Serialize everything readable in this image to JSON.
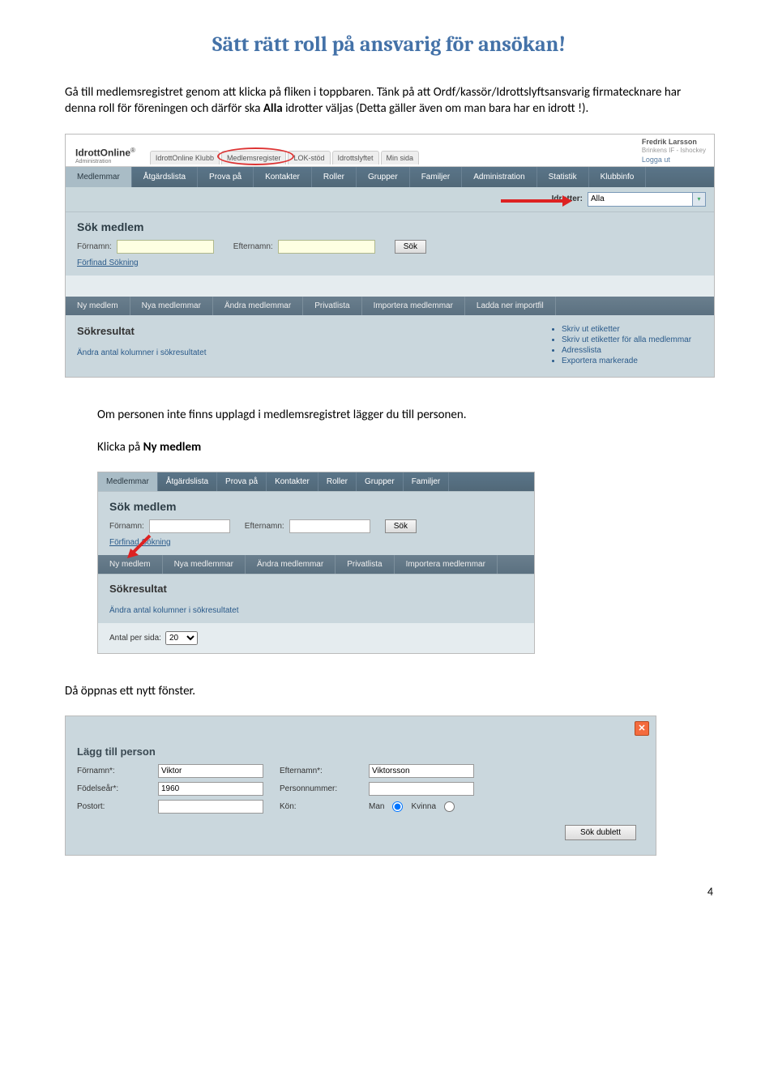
{
  "page_number": "4",
  "title": "Sätt rätt roll på ansvarig för ansökan!",
  "para1_a": "Gå till medlemsregistret genom att klicka på fliken i toppbaren. Tänk på att Ordf/kassör/Idrottslyftsansvarig firmatecknare har denna roll för föreningen och därför ska ",
  "para1_bold": "Alla",
  "para1_b": " idrotter väljas (Detta gäller även om man bara har en idrott !).",
  "para2": "Om personen inte finns upplagd i medlemsregistret lägger du till personen.",
  "para3_a": "Klicka på ",
  "para3_bold": "Ny medlem",
  "para4": "Då öppnas ett nytt fönster.",
  "shot1": {
    "logo": "IdrottOnline",
    "logoSub": "Administration",
    "topTabs": [
      "IdrottOnline Klubb",
      "Medlemsregister",
      "LOK-stöd",
      "Idrottslyftet",
      "Min sida"
    ],
    "user": {
      "name": "Fredrik Larsson",
      "org": "Brinkens IF - Ishockey",
      "logout": "Logga ut"
    },
    "nav": [
      "Medlemmar",
      "Åtgärdslista",
      "Prova på",
      "Kontakter",
      "Roller",
      "Grupper",
      "Familjer",
      "Administration",
      "Statistik",
      "Klubbinfo"
    ],
    "idrotter": {
      "label": "Idrotter:",
      "value": "Alla"
    },
    "sok": {
      "title": "Sök medlem",
      "fornamn": "Förnamn:",
      "efternamn": "Efternamn:",
      "btn": "Sök",
      "forfinad": "Förfinad Sökning"
    },
    "subnav": [
      "Ny medlem",
      "Nya medlemmar",
      "Ändra medlemmar",
      "Privatlista",
      "Importera medlemmar",
      "Ladda ner importfil"
    ],
    "result": {
      "title": "Sökresultat",
      "andra": "Ändra antal kolumner i sökresultatet",
      "links": [
        "Skriv ut etiketter",
        "Skriv ut etiketter för alla medlemmar",
        "Adresslista",
        "Exportera markerade"
      ]
    }
  },
  "shot2": {
    "nav": [
      "Medlemmar",
      "Åtgärdslista",
      "Prova på",
      "Kontakter",
      "Roller",
      "Grupper",
      "Familjer"
    ],
    "sok": {
      "title": "Sök medlem",
      "fornamn": "Förnamn:",
      "efternamn": "Efternamn:",
      "btn": "Sök",
      "forfinad": "Förfinad Sökning"
    },
    "subnav": [
      "Ny medlem",
      "Nya medlemmar",
      "Ändra medlemmar",
      "Privatlista",
      "Importera medlemmar"
    ],
    "result": {
      "title": "Sökresultat",
      "andra": "Ändra antal kolumner i sökresultatet"
    },
    "antal": {
      "label": "Antal per sida:",
      "value": "20"
    }
  },
  "shot3": {
    "title": "Lägg till person",
    "fields": {
      "fornamn": {
        "label": "Förnamn*:",
        "value": "Viktor"
      },
      "efternamn": {
        "label": "Efternamn*:",
        "value": "Viktorsson"
      },
      "fodelsear": {
        "label": "Födelseår*:",
        "value": "1960"
      },
      "personnummer": {
        "label": "Personnummer:",
        "value": ""
      },
      "postort": {
        "label": "Postort:",
        "value": ""
      },
      "kon": {
        "label": "Kön:",
        "man": "Man",
        "kvinna": "Kvinna"
      }
    },
    "btn": "Sök dublett"
  }
}
